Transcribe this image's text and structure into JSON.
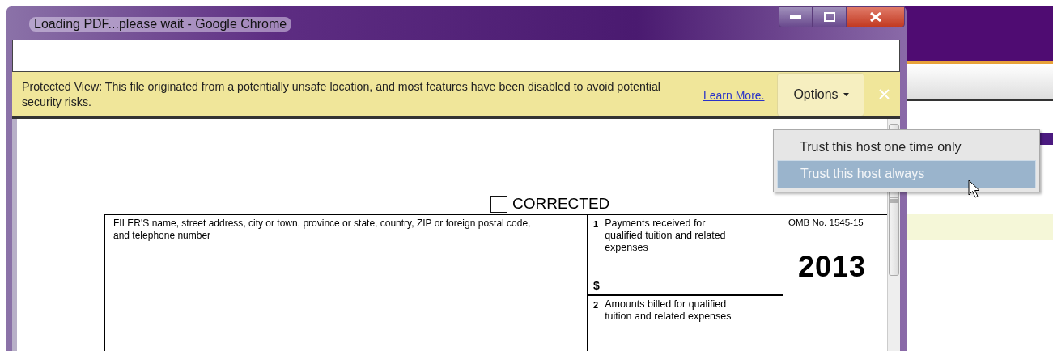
{
  "window": {
    "title": "Loading PDF...please wait - Google Chrome"
  },
  "info_bar": {
    "message": "Protected View: This file originated from a potentially unsafe location, and most features have been disabled to avoid potential security risks.",
    "link": "Learn More.",
    "options_button": "Options"
  },
  "options_menu": [
    {
      "label": "Trust this host one time only",
      "selected": false
    },
    {
      "label": "Trust this host always",
      "selected": true
    }
  ],
  "form": {
    "corrected": {
      "label": "CORRECTED",
      "checked": false
    },
    "filer_label": "FILER'S name, street address, city or town, province or state, country, ZIP or foreign postal code, and telephone number",
    "boxes": [
      {
        "number": "1",
        "label": "Payments received for qualified tuition and related expenses",
        "amount": "$"
      },
      {
        "number": "2",
        "label": "Amounts billed for qualified tuition and related expenses"
      }
    ],
    "omb": "OMB No. 1545-15",
    "year": "2013"
  }
}
